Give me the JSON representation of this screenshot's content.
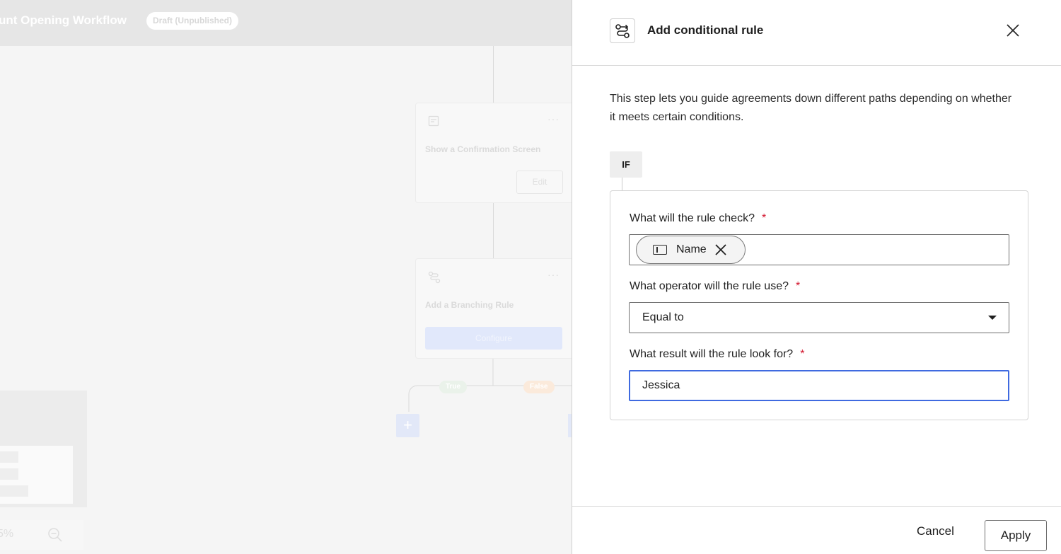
{
  "canvas": {
    "workflow_title": "unt Opening Workflow",
    "status_badge": "Draft (Unpublished)",
    "node_confirmation": {
      "title": "Show a Confirmation Screen",
      "edit_label": "Edit"
    },
    "node_branching": {
      "title": "Add a Branching Rule",
      "configure_label": "Configure"
    },
    "branch_true": "True",
    "branch_false": "False",
    "add_step": "+",
    "zoom_level": "5%"
  },
  "drawer": {
    "title": "Add conditional rule",
    "header_icon": "branch-icon",
    "description": "This step lets you guide agreements down different paths depending on whether it meets certain conditions.",
    "if_label": "IF",
    "check_label": "What will the rule check?",
    "check_chip": "Name",
    "operator_label": "What operator will the rule use?",
    "operator_value": "Equal to",
    "result_label": "What result will the rule look for?",
    "result_value": "Jessica",
    "required_marker": "*",
    "cancel_label": "Cancel",
    "apply_label": "Apply"
  },
  "colors": {
    "accent": "#3f6ae0",
    "required": "#d3172f"
  }
}
